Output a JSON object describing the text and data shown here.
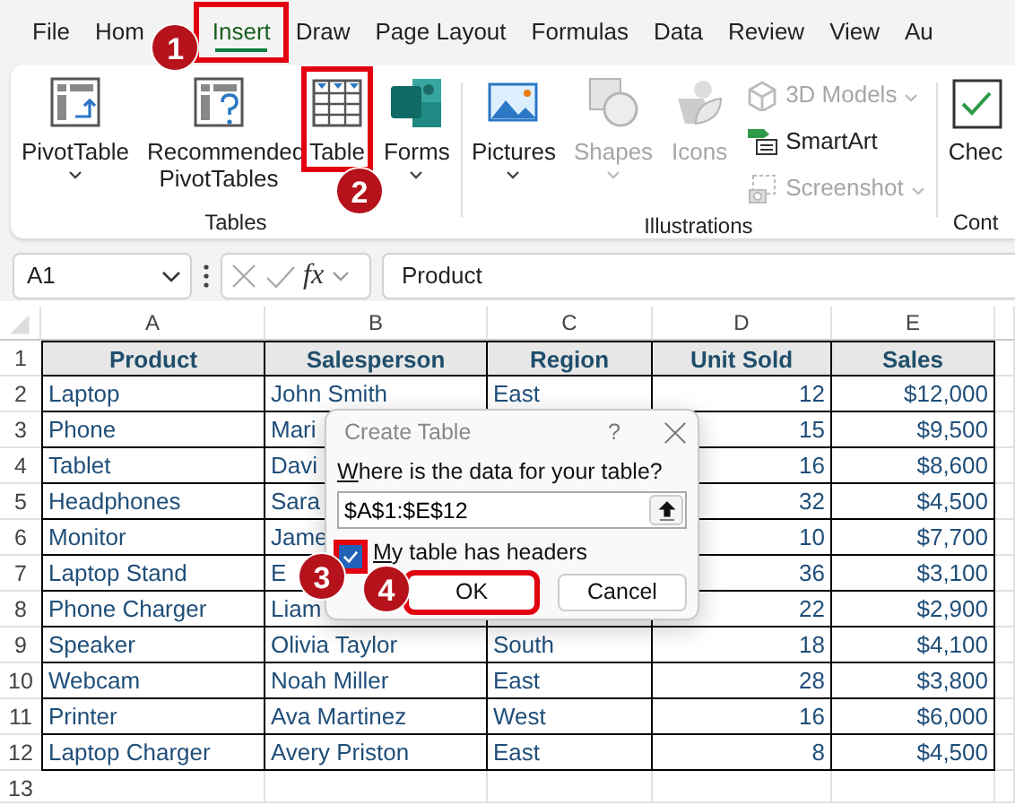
{
  "tabs": [
    {
      "label": "File",
      "selected": false
    },
    {
      "label": "Hom",
      "selected": false
    },
    {
      "label": "Insert",
      "selected": true,
      "callout": "1"
    },
    {
      "label": "Draw",
      "selected": false
    },
    {
      "label": "Page Layout",
      "selected": false
    },
    {
      "label": "Formulas",
      "selected": false
    },
    {
      "label": "Data",
      "selected": false
    },
    {
      "label": "Review",
      "selected": false
    },
    {
      "label": "View",
      "selected": false
    },
    {
      "label": "Au",
      "selected": false
    }
  ],
  "ribbon": {
    "groups": [
      {
        "label": "Tables",
        "items": [
          {
            "kind": "pivot",
            "label": "PivotTable",
            "dropdown": true,
            "disabled": false
          },
          {
            "kind": "recommended",
            "label": "Recommended PivotTables",
            "dropdown": false,
            "disabled": false
          },
          {
            "kind": "table",
            "label": "Table",
            "dropdown": false,
            "disabled": false,
            "callout": "2"
          },
          {
            "kind": "forms",
            "label": "Forms",
            "dropdown": true,
            "disabled": false
          }
        ]
      },
      {
        "label": "Illustrations",
        "items": [
          {
            "kind": "pictures",
            "label": "Pictures",
            "dropdown": true,
            "disabled": false
          },
          {
            "kind": "shapes",
            "label": "Shapes",
            "dropdown": true,
            "disabled": true
          },
          {
            "kind": "icons",
            "label": "Icons",
            "dropdown": false,
            "disabled": true
          },
          {
            "kind": "models",
            "label": "3D Models",
            "dropdown": true,
            "disabled": true
          },
          {
            "kind": "smartart",
            "label": "SmartArt",
            "dropdown": false,
            "disabled": false
          },
          {
            "kind": "screenshot",
            "label": "Screenshot",
            "dropdown": true,
            "disabled": true
          }
        ]
      },
      {
        "label": "Cont",
        "items": [
          {
            "kind": "checkbox",
            "label": "Chec",
            "dropdown": false,
            "disabled": false
          }
        ]
      }
    ]
  },
  "formula_bar": {
    "name_box": "A1",
    "function_label": "fx",
    "formula": "Product"
  },
  "columns": [
    {
      "letter": "A",
      "numeric": false
    },
    {
      "letter": "B",
      "numeric": false
    },
    {
      "letter": "C",
      "numeric": false
    },
    {
      "letter": "D",
      "numeric": true
    },
    {
      "letter": "E",
      "numeric": true
    }
  ],
  "rows": [
    {
      "number": "1",
      "kind": "header",
      "cells": [
        "Product",
        "Salesperson",
        "Region",
        "Unit Sold",
        "Sales"
      ]
    },
    {
      "number": "2",
      "kind": "data",
      "cells": [
        "Laptop",
        "John Smith",
        "East",
        "12",
        "$12,000"
      ]
    },
    {
      "number": "3",
      "kind": "data",
      "cells": [
        "Phone",
        "Mari",
        null,
        "15",
        "$9,500"
      ]
    },
    {
      "number": "4",
      "kind": "data",
      "cells": [
        "Tablet",
        "Davi",
        null,
        "16",
        "$8,600"
      ]
    },
    {
      "number": "5",
      "kind": "data",
      "cells": [
        "Headphones",
        "Sara",
        null,
        "32",
        "$4,500"
      ]
    },
    {
      "number": "6",
      "kind": "data",
      "cells": [
        "Monitor",
        "Jame",
        null,
        "10",
        "$7,700"
      ]
    },
    {
      "number": "7",
      "kind": "data",
      "cells": [
        "Laptop Stand",
        "E",
        null,
        "36",
        "$3,100"
      ]
    },
    {
      "number": "8",
      "kind": "data",
      "cells": [
        "Phone Charger",
        "Liam",
        null,
        "22",
        "$2,900"
      ]
    },
    {
      "number": "9",
      "kind": "data",
      "cells": [
        "Speaker",
        "Olivia Taylor",
        "South",
        "18",
        "$4,100"
      ]
    },
    {
      "number": "10",
      "kind": "data",
      "cells": [
        "Webcam",
        "Noah Miller",
        "East",
        "28",
        "$3,800"
      ]
    },
    {
      "number": "11",
      "kind": "data",
      "cells": [
        "Printer",
        "Ava Martinez",
        "West",
        "16",
        "$6,000"
      ]
    },
    {
      "number": "12",
      "kind": "data",
      "cells": [
        "Laptop Charger",
        "Avery Priston",
        "East",
        "8",
        "$4,500"
      ]
    },
    {
      "number": "13",
      "kind": "empty"
    }
  ],
  "dialog": {
    "title": "Create Table",
    "help": "?",
    "range_label": "Where is the data for your table?",
    "range_value": "$A$1:$E$12",
    "headers_checkbox": {
      "label": "My table has headers",
      "checked": true,
      "callout": "3"
    },
    "buttons": [
      {
        "label": "OK",
        "default": true,
        "callout": "4"
      },
      {
        "label": "Cancel",
        "default": false
      }
    ]
  }
}
